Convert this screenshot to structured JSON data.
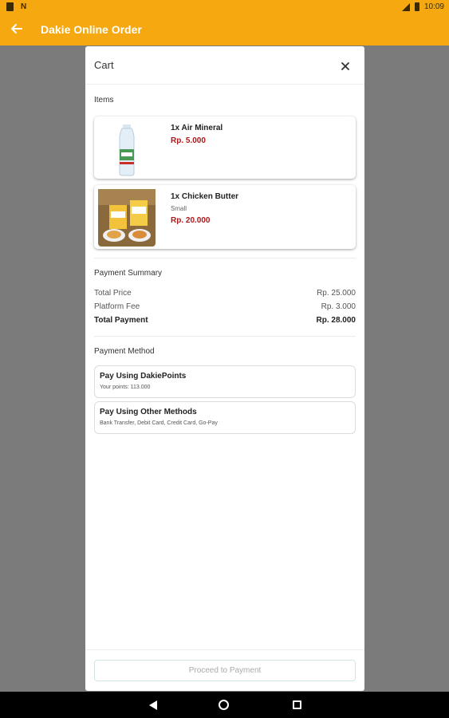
{
  "status_bar": {
    "time": "10:09"
  },
  "app_bar": {
    "title": "Dakie Online Order"
  },
  "cart": {
    "title": "Cart",
    "items_label": "Items",
    "items": [
      {
        "name": "1x Air Mineral",
        "variant": "",
        "price": "Rp. 5.000"
      },
      {
        "name": "1x Chicken Butter",
        "variant": "Small",
        "price": "Rp. 20.000"
      }
    ]
  },
  "payment_summary": {
    "label": "Payment Summary",
    "rows": [
      {
        "label": "Total Price",
        "value": "Rp. 25.000"
      },
      {
        "label": "Platform Fee",
        "value": "Rp. 3.000"
      },
      {
        "label": "Total Payment",
        "value": "Rp. 28.000"
      }
    ]
  },
  "payment_method": {
    "label": "Payment Method",
    "options": [
      {
        "title": "Pay Using DakiePoints",
        "subtitle": "Your points: 113.000"
      },
      {
        "title": "Pay Using Other Methods",
        "subtitle": "Bank Transfer, Debit Card, Credit Card, Go-Pay"
      }
    ]
  },
  "footer": {
    "proceed_label": "Proceed to Payment"
  },
  "colors": {
    "accent": "#f5a80f",
    "price": "#b0161a"
  }
}
